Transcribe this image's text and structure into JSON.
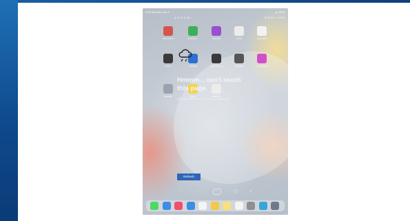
{
  "statusbar": {
    "left": "9:41 AM  Mon Jan 9",
    "right": "▲ 100%"
  },
  "browser": {
    "tab_time": "8:12 ⊕ ⊗ ⊞ ▾",
    "tab_right": "⊞ ⊞ ⊗ ▾ ○ 100%"
  },
  "home_icons": [
    {
      "name": "photo-booth",
      "label": "Photo Booth",
      "color": "#d5544e"
    },
    {
      "name": "facetime",
      "label": "FaceTime",
      "color": "#3fae5b"
    },
    {
      "name": "podcasts",
      "label": "Podcasts",
      "color": "#9a4fd0"
    },
    {
      "name": "clock",
      "label": "Clock",
      "color": "#ececec"
    },
    {
      "name": "reminders",
      "label": "Reminders",
      "color": "#f2f2f2"
    },
    {
      "name": "stocks",
      "label": "Stocks",
      "color": "#3a3a3a"
    },
    {
      "name": "translate",
      "label": "Translate",
      "color": "#2f6fd0"
    },
    {
      "name": "voice-memos",
      "label": "Voice Memos",
      "color": "#3a3a3a"
    },
    {
      "name": "calculator",
      "label": "Calculator",
      "color": "#555555"
    },
    {
      "name": "itunes-store",
      "label": "iTunes Store",
      "color": "#d04fc8"
    },
    {
      "name": "magnifier",
      "label": "Magnifier",
      "color": "#9aa4b0"
    },
    {
      "name": "notes",
      "label": "Notes",
      "color": "#f2d44c"
    },
    {
      "name": "calendar",
      "label": "Calendar",
      "color": "#ececec"
    }
  ],
  "error": {
    "title": "Hmmm... can't reach this page",
    "subtitle": "Check if there is a typo in connect.sec.",
    "detail": "DNS_PROBE_FINISHED_NXDOMAIN"
  },
  "reload_label": "Refresh",
  "toolbar": {
    "back": "←",
    "forward": "→",
    "tabs": "⋯",
    "share": "⊡",
    "settings": "≺"
  },
  "dock": [
    {
      "name": "messages",
      "color": "#4cd964"
    },
    {
      "name": "safari",
      "color": "#3d8de6"
    },
    {
      "name": "music",
      "color": "#f0506e"
    },
    {
      "name": "mail",
      "color": "#3d8de6"
    },
    {
      "name": "files",
      "color": "#f4f4f4"
    },
    {
      "name": "photos",
      "color": "#f4c84a"
    },
    {
      "name": "notes",
      "color": "#f8e07a"
    },
    {
      "name": "calendar",
      "color": "#f4f4f4"
    },
    {
      "name": "settings",
      "color": "#8e8e93"
    },
    {
      "name": "edge",
      "color": "#35a6d8"
    },
    {
      "name": "app-library",
      "color": "#6e7a8a"
    }
  ]
}
